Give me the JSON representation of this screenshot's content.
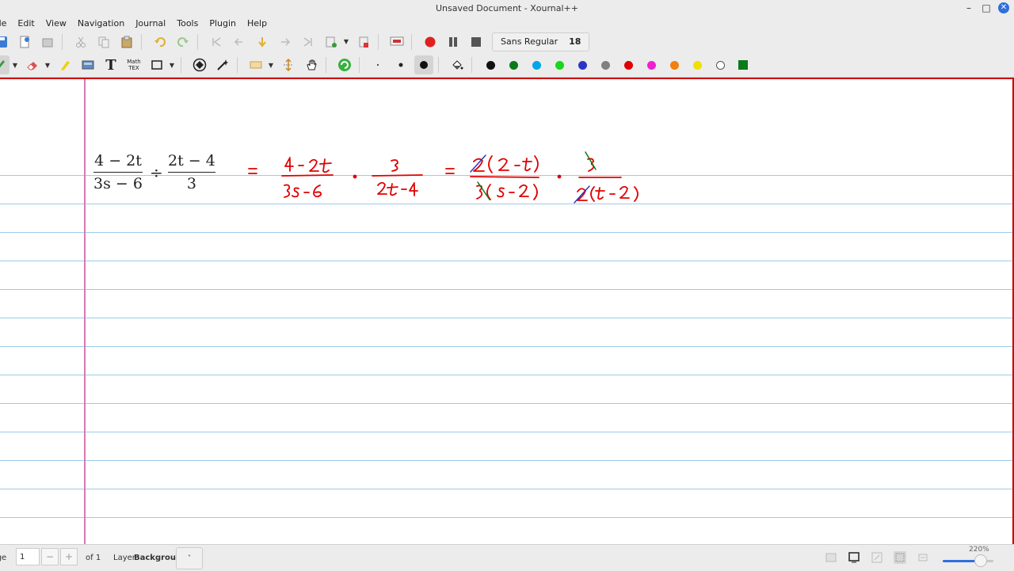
{
  "window": {
    "title": "Unsaved Document - Xournal++"
  },
  "menu": [
    "File",
    "Edit",
    "View",
    "Navigation",
    "Journal",
    "Tools",
    "Plugin",
    "Help"
  ],
  "font_button": {
    "name": "Sans Regular",
    "size": "18"
  },
  "colors": [
    {
      "name": "black",
      "hex": "#111111",
      "selected": false
    },
    {
      "name": "green",
      "hex": "#0a7a1a",
      "selected": true
    },
    {
      "name": "light-blue",
      "hex": "#00a6e6",
      "selected": false
    },
    {
      "name": "light-green",
      "hex": "#18d818",
      "selected": false
    },
    {
      "name": "blue",
      "hex": "#2a35c8",
      "selected": false
    },
    {
      "name": "gray",
      "hex": "#808080",
      "selected": false
    },
    {
      "name": "red",
      "hex": "#e00000",
      "selected": false
    },
    {
      "name": "magenta",
      "hex": "#f020d0",
      "selected": false
    },
    {
      "name": "orange",
      "hex": "#f08010",
      "selected": false
    },
    {
      "name": "yellow",
      "hex": "#f0e000",
      "selected": false
    },
    {
      "name": "white",
      "hex": "#ffffff",
      "selected": false
    }
  ],
  "expression": {
    "frac1": {
      "num": "4 − 2t",
      "den": "3s − 6"
    },
    "op": "÷",
    "frac2": {
      "num": "2t − 4",
      "den": "3"
    }
  },
  "status": {
    "page_label": "Page",
    "page_value": "1",
    "minus": "−",
    "plus": "+",
    "of_pages": "of 1",
    "layer_label": "Layer",
    "layer_value": "Background",
    "zoom": "220%",
    "zoom_fraction": 0.7
  }
}
